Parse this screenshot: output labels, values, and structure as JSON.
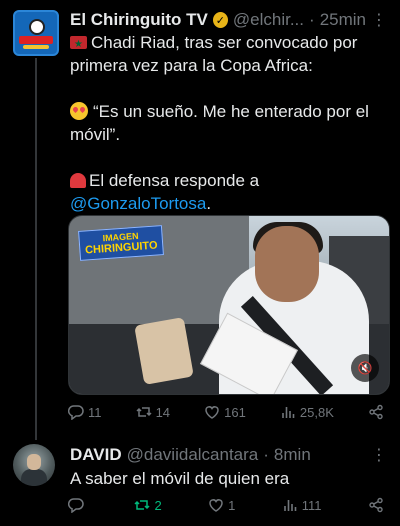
{
  "tweet": {
    "author": "El Chiringuito TV",
    "handle": "@elchir...",
    "separator": "·",
    "time": "25min",
    "lines": {
      "l1": "Chadi Riad, tras ser convocado por",
      "l2": "primera vez para la Copa Africa:",
      "l3": "“Es un sueño. Me he enterado por el",
      "l4": "móvil”.",
      "l5": "El defensa responde a",
      "mention": "@GonzaloTortosa",
      "l6_end": "."
    },
    "media": {
      "watermark_line1": "IMAGEN",
      "watermark_line2": "CHIRINGUITO",
      "mute_icon": "speaker-muted-icon"
    },
    "stats": {
      "replies": "11",
      "reposts": "14",
      "likes": "161",
      "views": "25,8K"
    }
  },
  "reply": {
    "author": "DAVID",
    "handle": "@daviidalcantara",
    "separator": "·",
    "time": "8min",
    "text": "A saber el móvil de quien era",
    "stats": {
      "replies": "",
      "reposts": "2",
      "likes": "1",
      "views": "111"
    }
  },
  "colors": {
    "background": "#000000",
    "text": "#e7e9ea",
    "muted": "#71767b",
    "link": "#1d9bf0",
    "repost_active": "#00ba7c",
    "verified_gold": "#e8b418"
  }
}
